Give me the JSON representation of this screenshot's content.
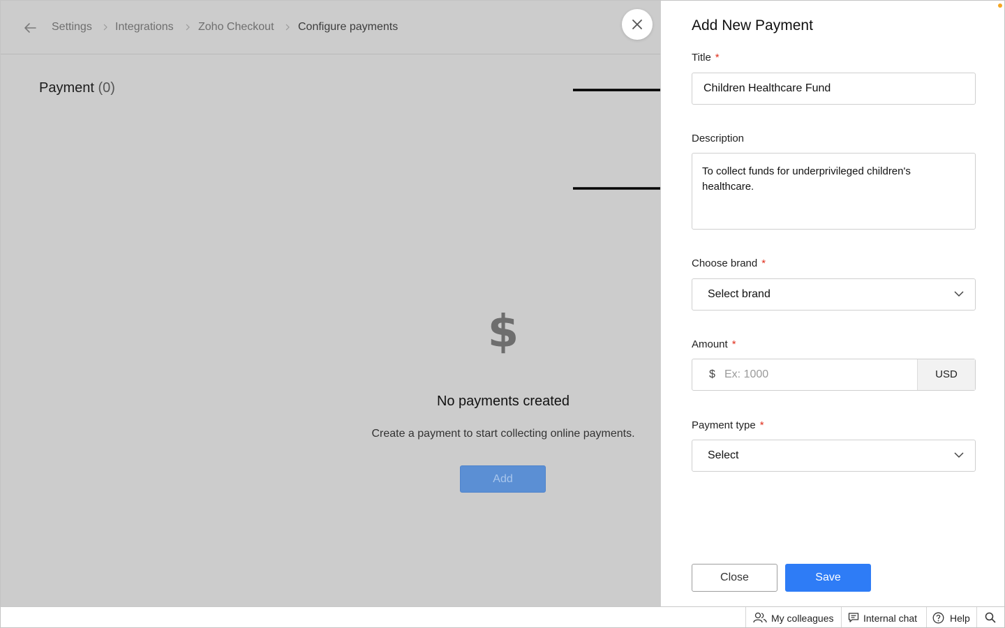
{
  "breadcrumb": {
    "items": [
      "Settings",
      "Integrations",
      "Zoho Checkout",
      "Configure payments"
    ]
  },
  "page": {
    "title": "Payment",
    "count": "(0)"
  },
  "empty_state": {
    "icon": "dollar-icon",
    "glyph": "$",
    "title": "No payments created",
    "text": "Create a payment to start collecting online payments.",
    "add_label": "Add"
  },
  "panel": {
    "title": "Add New Payment",
    "required_mark": "*",
    "title_field": {
      "label": "Title",
      "value": "Children Healthcare Fund"
    },
    "description_field": {
      "label": "Description",
      "value": "To collect funds for underprivileged children's healthcare."
    },
    "brand_field": {
      "label": "Choose brand",
      "value": "Select brand"
    },
    "amount_field": {
      "label": "Amount",
      "prefix": "$",
      "placeholder": "Ex: 1000",
      "currency": "USD"
    },
    "payment_type_field": {
      "label": "Payment type",
      "value": "Select"
    },
    "close_label": "Close",
    "save_label": "Save"
  },
  "bottom_bar": {
    "colleagues": "My colleagues",
    "chat": "Internal chat",
    "help": "Help"
  },
  "colors": {
    "overlay": "#cccccc",
    "accent": "#2e7cf6",
    "required": "#e0301e",
    "notification": "#f5a623"
  }
}
